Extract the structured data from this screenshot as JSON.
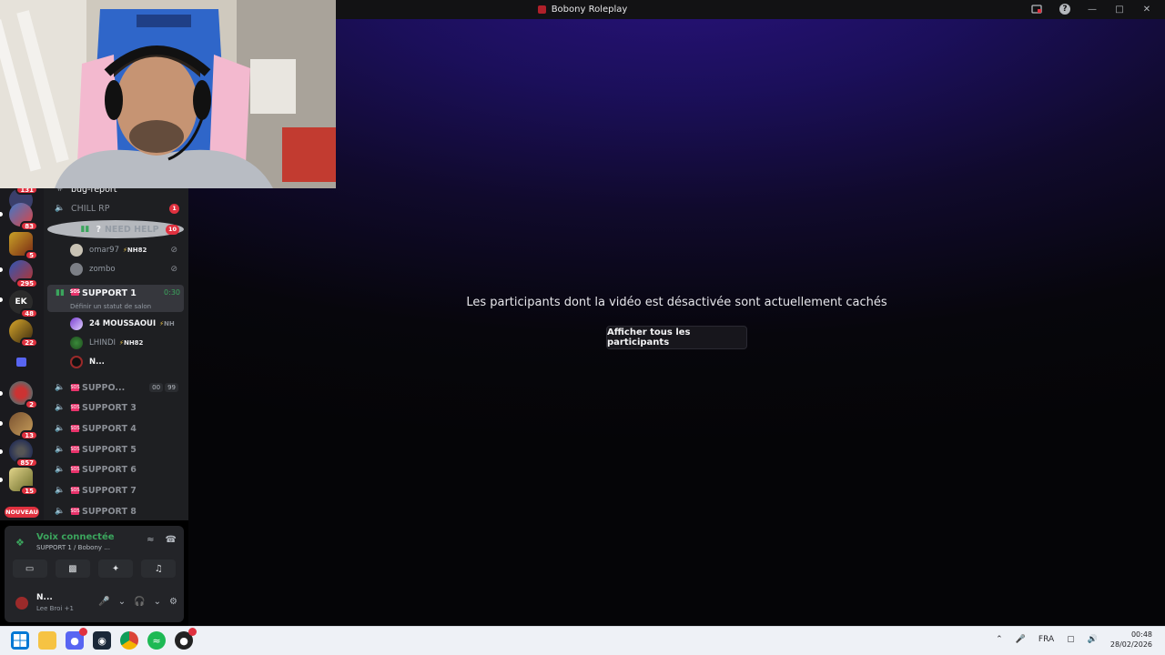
{
  "window": {
    "title": "Bobony Roleplay"
  },
  "stage": {
    "message": "Les participants dont la vidéo est désactivée sont actuellement cachés",
    "show_all_label": "Afficher tous les participants"
  },
  "servers": [
    {
      "badge": "131"
    },
    {
      "badge": "83"
    },
    {
      "badge": "5"
    },
    {
      "badge": "295"
    },
    {
      "badge": "48"
    },
    {
      "badge": "22"
    },
    {
      "badge": "2"
    },
    {
      "badge": "13"
    },
    {
      "badge": "857"
    },
    {
      "badge": "15"
    }
  ],
  "servers_new_label": "NOUVEAU",
  "channels": {
    "partial_top": "bug-report",
    "chill": {
      "name": "CHILL RP",
      "badge": "1"
    },
    "need_help": {
      "name": "NEED HELP",
      "badge": "10"
    },
    "need_help_users": [
      {
        "name": "omar97",
        "tag": "NH82"
      },
      {
        "name": "zombo",
        "tag": ""
      }
    ],
    "support1": {
      "name": "SUPPORT 1",
      "timer": "0:30",
      "status": "Définir un statut de salon"
    },
    "support1_users": [
      {
        "name": "24 MOUSSAOUI",
        "tag": "NH"
      },
      {
        "name": "LHINDI",
        "tag": "NH82"
      },
      {
        "name": "N...",
        "tag": ""
      }
    ],
    "support2": {
      "name": "SUPPO...",
      "limit_a": "00",
      "limit_b": "99"
    },
    "others": [
      "SUPPORT 3",
      "SUPPORT 4",
      "SUPPORT 5",
      "SUPPORT 6",
      "SUPPORT 7",
      "SUPPORT 8"
    ]
  },
  "voice": {
    "title": "Voix connectée",
    "subtitle": "SUPPORT 1 / Bobony ..."
  },
  "me": {
    "name": "N...",
    "song": "Lee Broi +1"
  },
  "taskbar": {
    "lang": "FRA",
    "time": "00:48",
    "date": "28/02/2026"
  }
}
